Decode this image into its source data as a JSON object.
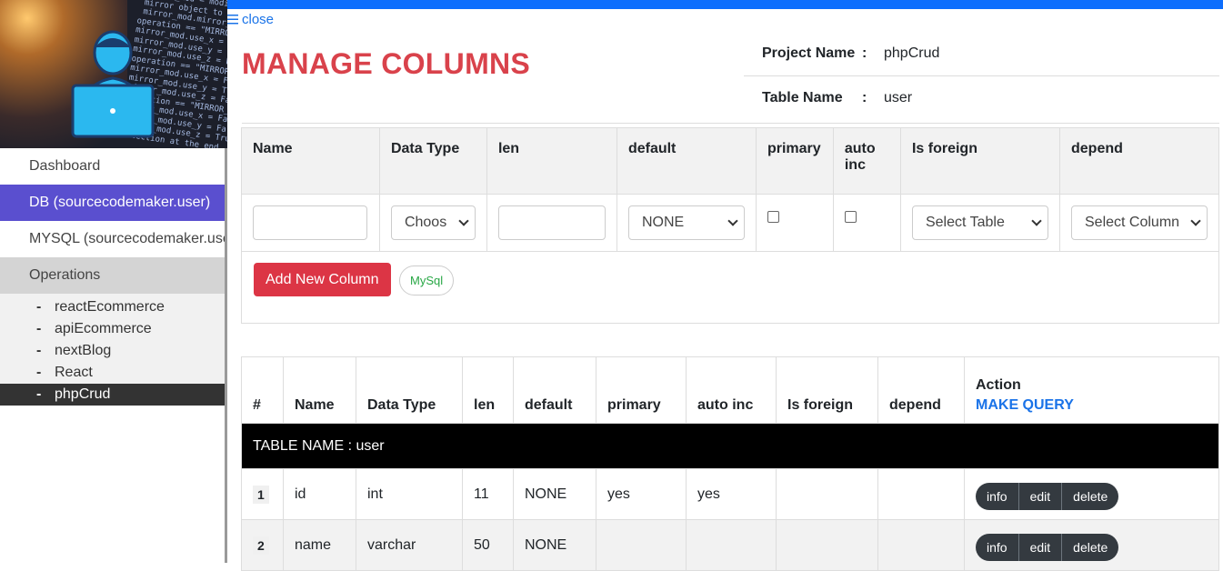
{
  "sidebar": {
    "items": [
      {
        "label": "Dashboard"
      },
      {
        "label": "DB (sourcecodemaker.user)"
      },
      {
        "label": "MYSQL (sourcecodemaker.user)"
      },
      {
        "label": "Operations"
      }
    ],
    "projects": [
      "reactEcommerce",
      "apiEcommerce",
      "nextBlog",
      "React",
      "phpCrud"
    ],
    "dash": "-"
  },
  "header": {
    "close": "close",
    "title": "MANAGE COLUMNS",
    "project_label": "Project Name",
    "project_value": "phpCrud",
    "table_label": "Table Name",
    "table_value": "user",
    "colon": ":"
  },
  "form": {
    "headers": [
      "Name",
      "Data Type",
      "len",
      "default",
      "primary",
      "auto inc",
      "Is foreign",
      "depend"
    ],
    "datatype_value": "Choos",
    "default_value": "NONE",
    "foreign_value": "Select Table",
    "depend_value": "Select Column",
    "add_button": "Add New Column",
    "mysql_button": "MySql"
  },
  "table": {
    "headers": [
      "#",
      "Name",
      "Data Type",
      "len",
      "default",
      "primary",
      "auto inc",
      "Is foreign",
      "depend"
    ],
    "action_label": "Action",
    "make_query": "MAKE QUERY",
    "table_name_row": "TABLE NAME : user",
    "rows": [
      {
        "num": "1",
        "name": "id",
        "type": "int",
        "len": "11",
        "default": "NONE",
        "primary": "yes",
        "auto_inc": "yes",
        "foreign": "",
        "depend": ""
      },
      {
        "num": "2",
        "name": "name",
        "type": "varchar",
        "len": "50",
        "default": "NONE",
        "primary": "",
        "auto_inc": "",
        "foreign": "",
        "depend": ""
      }
    ],
    "actions": [
      "info",
      "edit",
      "delete"
    ]
  },
  "colors": {
    "accent": "#0d6efd",
    "title": "#d9424b",
    "active_nav": "#5a4fcf",
    "danger": "#dc3545"
  },
  "icons": {
    "close": "hamburger-icon",
    "person": "coder-avatar-icon"
  }
}
